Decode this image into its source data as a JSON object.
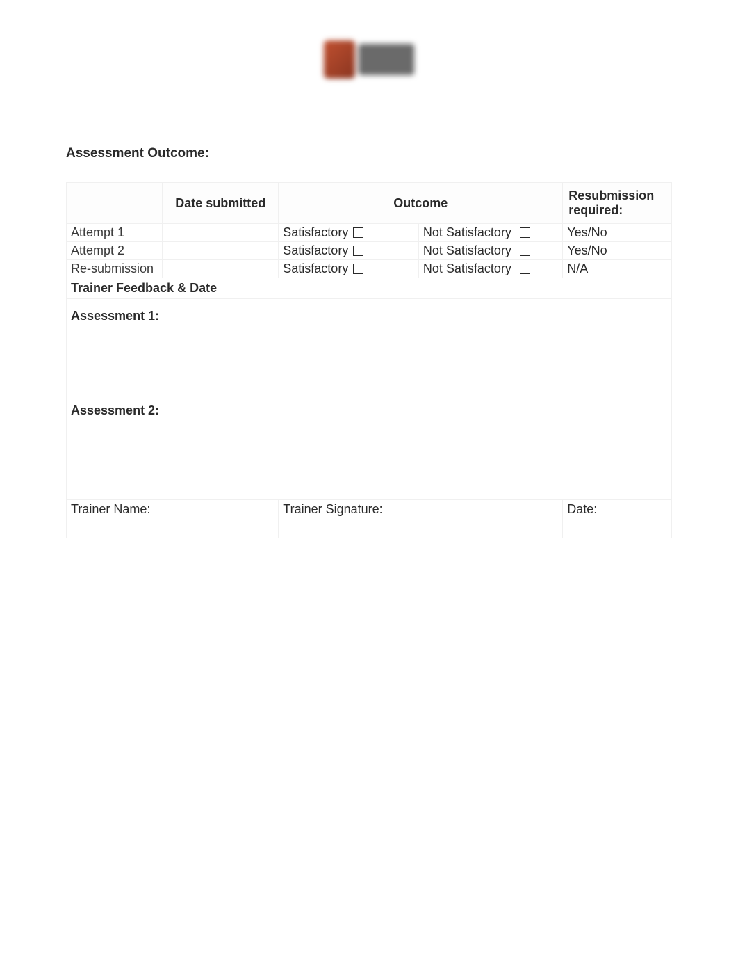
{
  "section_title": "Assessment Outcome:",
  "headers": {
    "attempt": "",
    "date_submitted": "Date submitted",
    "outcome": "Outcome",
    "resubmission": "Resubmission required:"
  },
  "rows": [
    {
      "attempt": "Attempt 1",
      "date": "",
      "satisfactory": "Satisfactory",
      "not_satisfactory": "Not Satisfactory",
      "resubmission": "Yes/No"
    },
    {
      "attempt": "Attempt 2",
      "date": "",
      "satisfactory": "Satisfactory",
      "not_satisfactory": "Not Satisfactory",
      "resubmission": "Yes/No"
    },
    {
      "attempt": "Re-submission",
      "date": "",
      "satisfactory": "Satisfactory",
      "not_satisfactory": "Not Satisfactory",
      "resubmission": "N/A"
    }
  ],
  "feedback_header": "Trainer Feedback & Date",
  "feedback": {
    "assessment1": "Assessment 1:",
    "assessment2": "Assessment 2:"
  },
  "bottom": {
    "trainer_name": "Trainer Name:",
    "trainer_signature": "Trainer Signature:",
    "date": "Date:"
  }
}
